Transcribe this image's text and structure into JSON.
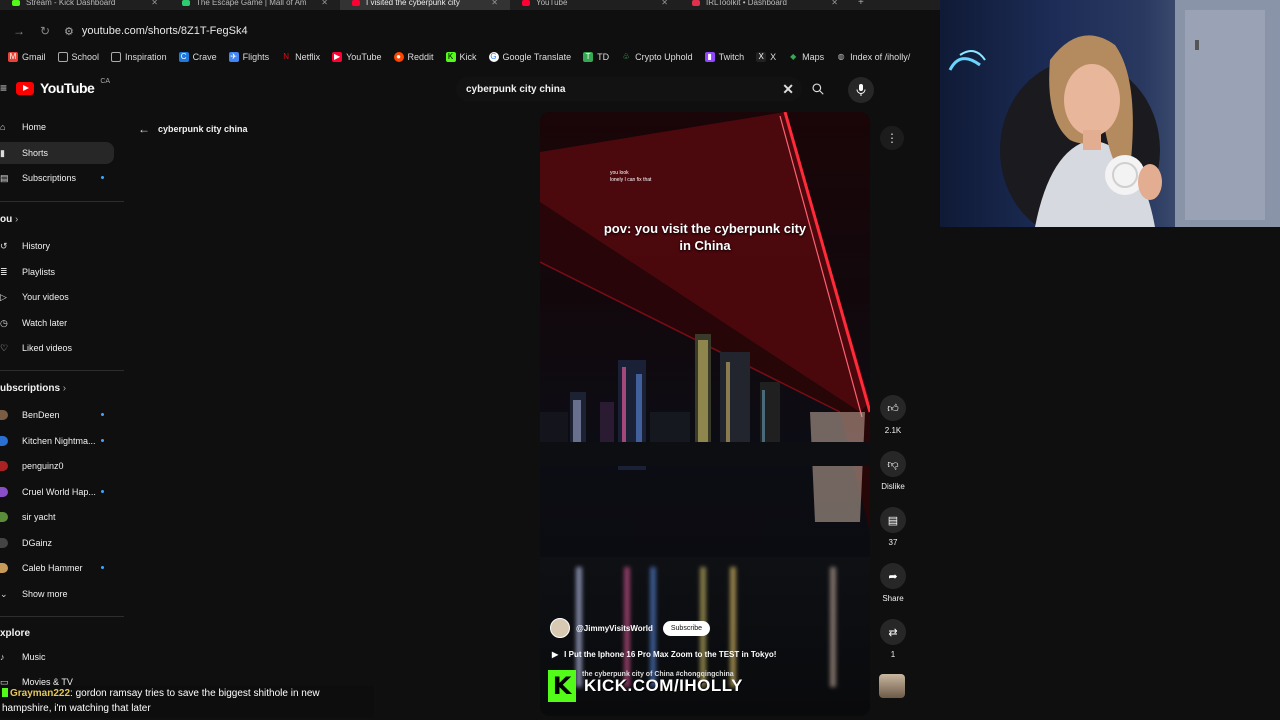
{
  "browser": {
    "tabs": [
      {
        "label": "Stream - Kick Dashboard",
        "color": "#53fc18"
      },
      {
        "label": "The Escape Game | Mall of Am",
        "color": "#2ecc71"
      },
      {
        "label": "I visited the cyberpunk city",
        "color": "#ff0033",
        "active": true
      },
      {
        "label": "YouTube",
        "color": "#ff0033"
      },
      {
        "label": "IRLToolkit • Dashboard",
        "color": "#e0304d"
      }
    ],
    "new_tab": "+",
    "url": "youtube.com/shorts/8Z1T-FegSk4",
    "bookmarks": [
      {
        "label": "Gmail",
        "color": "#ea4335"
      },
      {
        "label": "School",
        "color": "#888888"
      },
      {
        "label": "Inspiration",
        "color": "#888888"
      },
      {
        "label": "Crave",
        "color": "#1f7ae0"
      },
      {
        "label": "Flights",
        "color": "#4285f4"
      },
      {
        "label": "Netflix",
        "color": "#e50914"
      },
      {
        "label": "YouTube",
        "color": "#ff0033"
      },
      {
        "label": "Reddit",
        "color": "#ff4500"
      },
      {
        "label": "Kick",
        "color": "#53fc18"
      },
      {
        "label": "Google Translate",
        "color": "#4285f4"
      },
      {
        "label": "TD",
        "color": "#34a853"
      },
      {
        "label": "Crypto Uphold",
        "color": "#49cc68"
      },
      {
        "label": "Twitch",
        "color": "#9146ff"
      },
      {
        "label": "X",
        "color": "#222222"
      },
      {
        "label": "Maps",
        "color": "#34a853"
      },
      {
        "label": "Index of /iholly/",
        "color": "#888888"
      }
    ]
  },
  "youtube": {
    "logo_text": "YouTube",
    "region": "CA",
    "search_value": "cyberpunk city china",
    "back_title": "cyberpunk city china"
  },
  "sidebar": {
    "main": [
      {
        "label": "Home",
        "icon": "home-icon"
      },
      {
        "label": "Shorts",
        "icon": "shorts-icon",
        "active": true
      },
      {
        "label": "Subscriptions",
        "icon": "subscriptions-icon",
        "dot": true
      }
    ],
    "you_heading": "ou",
    "you": [
      {
        "label": "History",
        "icon": "history-icon"
      },
      {
        "label": "Playlists",
        "icon": "playlists-icon"
      },
      {
        "label": "Your videos",
        "icon": "your-videos-icon"
      },
      {
        "label": "Watch later",
        "icon": "watch-later-icon"
      },
      {
        "label": "Liked videos",
        "icon": "liked-videos-icon"
      }
    ],
    "subs_heading": "ubscriptions",
    "subs": [
      {
        "label": "BenDeen",
        "color": "#7a5c44",
        "dot": true
      },
      {
        "label": "Kitchen Nightma...",
        "color": "#2a6fd1",
        "dot": true
      },
      {
        "label": "penguinz0",
        "color": "#aa2222",
        "dot": false
      },
      {
        "label": "Cruel World Hap...",
        "color": "#8a4fc8",
        "dot": true
      },
      {
        "label": "sir yacht",
        "color": "#5b8c3a",
        "dot": false
      },
      {
        "label": "DGainz",
        "color": "#444444",
        "dot": false
      },
      {
        "label": "Caleb Hammer",
        "color": "#c89a5a",
        "dot": true
      }
    ],
    "show_more": "Show more",
    "explore_heading": "xplore",
    "explore": [
      {
        "label": "Music",
        "icon": "music-icon"
      },
      {
        "label": "Movies & TV",
        "icon": "movies-icon"
      }
    ]
  },
  "video": {
    "small_text_1": "you look",
    "small_text_2": "lonely I can fix that",
    "title_line1": "pov: you visit the cyberpunk city",
    "title_line2": "in China",
    "channel": "@JimmyVisitsWorld",
    "subscribe": "Subscribe",
    "related": "I Put the Iphone 16 Pro Max Zoom to the TEST in Tokyo!",
    "description": "the cyberpunk city of China #chongqingchina"
  },
  "actions": {
    "likes": "2.1K",
    "dislike": "Dislike",
    "comments": "37",
    "share": "Share",
    "remix": "1"
  },
  "kick": {
    "logo": "K",
    "text": "KICK.COM/IHOLLY"
  },
  "chat": {
    "username": "Grayman222",
    "message_1": ": gordon ramsay tries to save the biggest shithole in new",
    "message_2": "hampshire, i'm watching that later"
  }
}
